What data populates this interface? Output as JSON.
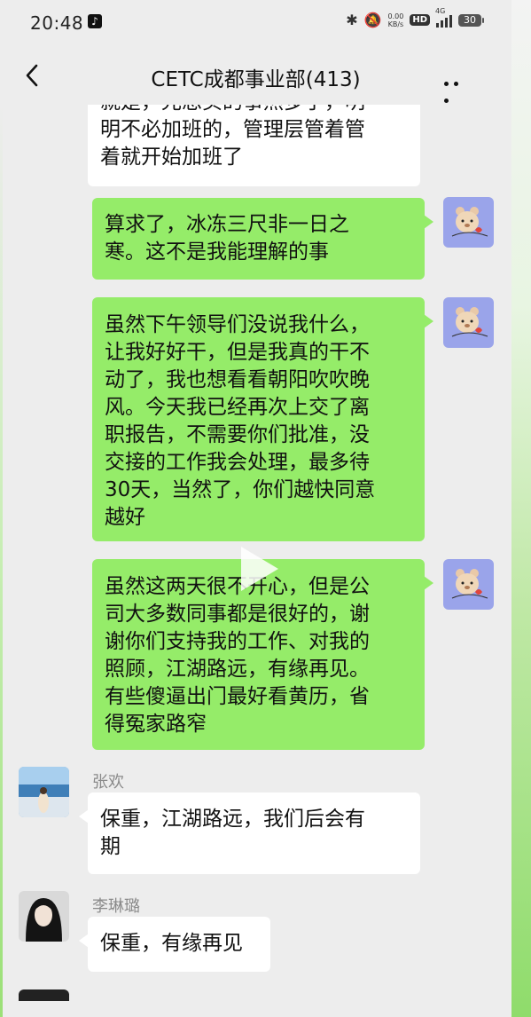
{
  "status_bar": {
    "time": "20:48",
    "net_speed_value": "0.00",
    "net_speed_unit": "KB/s",
    "hd": "HD",
    "network": "4G",
    "battery": "30"
  },
  "header": {
    "title": "CETC成都事业部(413)"
  },
  "messages": {
    "m0": {
      "text_l1": "就是，光想买的事然多了，明",
      "text_l2": "明不必加班的，管理层管着管",
      "text_l3": "着就开始加班了"
    },
    "m1": {
      "text_l1": "算求了，冰冻三尺非一日之",
      "text_l2": "寒。这不是我能理解的事"
    },
    "m2": {
      "text_l1": "虽然下午领导们没说我什么，",
      "text_l2": "让我好好干，但是我真的干不",
      "text_l3": "动了，我也想看看朝阳吹吹晚",
      "text_l4": "风。今天我已经再次上交了离",
      "text_l5": "职报告，不需要你们批准，没",
      "text_l6": "交接的工作我会处理，最多待",
      "text_l7": "30天，当然了，你们越快同意",
      "text_l8": "越好"
    },
    "m3": {
      "text_l1": "虽然这两天很不开心，但是公",
      "text_l2": "司大多数同事都是很好的，谢",
      "text_l3": "谢你们支持我的工作、对我的",
      "text_l4": "照顾，江湖路远，有缘再见。",
      "text_l5": "有些傻逼出门最好看黄历，省",
      "text_l6": "得冤家路窄"
    },
    "m4": {
      "sender": "张欢",
      "text_l1": "保重，江湖路远，我们后会有",
      "text_l2": "期"
    },
    "m5": {
      "sender": "李琳璐",
      "text_l1": "保重，有缘再见"
    }
  },
  "colors": {
    "sent_bubble": "#95ec69",
    "recv_bubble": "#ffffff",
    "background": "#ededed"
  }
}
